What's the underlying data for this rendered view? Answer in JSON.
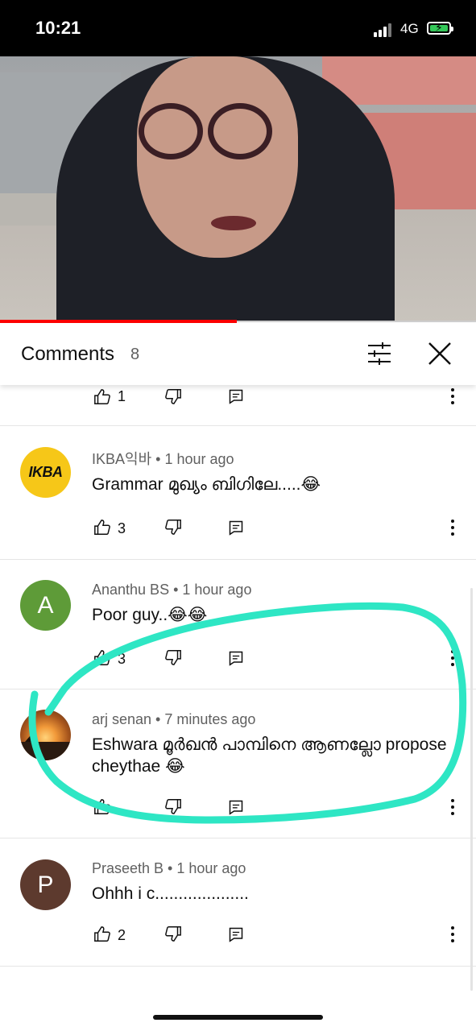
{
  "status_bar": {
    "time": "10:21",
    "network": "4G",
    "battery_color": "#34c759"
  },
  "comments_panel": {
    "title": "Comments",
    "count": "8",
    "icons": {
      "filter": "sliders-icon",
      "close": "close-icon"
    }
  },
  "video": {
    "progress_fraction": 0.5,
    "progress_color": "#ff0000"
  },
  "comments": [
    {
      "id": "partial",
      "likes": "1"
    },
    {
      "id": "ikba",
      "avatar_text": "IKBA",
      "avatar_color": "#f6c718",
      "meta": "IKBA익바 • 1 hour ago",
      "text": "Grammar മുഖ്യം ബിഗിലേ.....😂",
      "likes": "3"
    },
    {
      "id": "ananthu",
      "avatar_text": "A",
      "avatar_color": "#5e9b38",
      "meta": "Ananthu BS • 1 hour ago",
      "text": "Poor guy..😂😂",
      "likes": "3"
    },
    {
      "id": "arj",
      "meta": "arj senan • 7 minutes ago",
      "text": "Eshwara മൂർഖൻ പാമ്പിനെ ആണല്ലോ propose cheythae 😂",
      "likes": ""
    },
    {
      "id": "praseeth",
      "avatar_text": "P",
      "avatar_color": "#5d3a2e",
      "meta": "Praseeth B • 1 hour ago",
      "text": "Ohhh i c....................",
      "likes": "2"
    }
  ],
  "annotation_color": "#2ee6c4"
}
